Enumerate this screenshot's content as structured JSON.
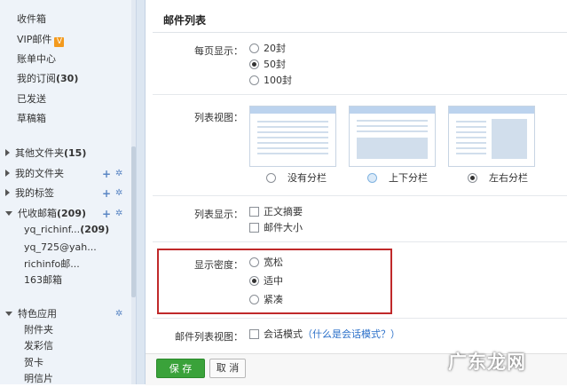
{
  "sidebar": {
    "items": [
      {
        "label": "收件箱"
      },
      {
        "label": "VIP邮件",
        "badge": "V"
      },
      {
        "label": "账单中心"
      },
      {
        "label": "我的订阅",
        "count": "(30)"
      },
      {
        "label": "已发送"
      },
      {
        "label": "草稿箱"
      }
    ],
    "folders": [
      {
        "label": "其他文件夹",
        "count": "(15)"
      },
      {
        "label": "我的文件夹"
      },
      {
        "label": "我的标签"
      },
      {
        "label": "代收邮箱",
        "count": "(209)"
      }
    ],
    "sub_accounts": [
      {
        "label": "yq_richinf...",
        "count": "(209)"
      },
      {
        "label": "yq_725@yah..."
      },
      {
        "label": "richinfo邮..."
      },
      {
        "label": "163邮箱"
      }
    ],
    "features": {
      "label": "特色应用",
      "items": [
        {
          "label": "附件夹"
        },
        {
          "label": "发彩信"
        },
        {
          "label": "贺卡"
        },
        {
          "label": "明信片"
        }
      ]
    }
  },
  "main": {
    "title": "邮件列表",
    "per_page": {
      "label": "每页显示：",
      "options": [
        "20封",
        "50封",
        "100封"
      ],
      "selected": "50封"
    },
    "list_view": {
      "label": "列表视图：",
      "options": [
        "没有分栏",
        "上下分栏",
        "左右分栏"
      ],
      "selected": "左右分栏"
    },
    "list_display": {
      "label": "列表显示：",
      "options": [
        "正文摘要",
        "邮件大小"
      ]
    },
    "density": {
      "label": "显示密度：",
      "options": [
        "宽松",
        "适中",
        "紧凑"
      ],
      "selected": "适中"
    },
    "mail_list_view": {
      "label": "邮件列表视图：",
      "option": "会话模式",
      "link": "（什么是会话模式？）"
    },
    "save_label": "保 存",
    "cancel_label": "取 消"
  },
  "watermark": "广东龙网",
  "colors": {
    "accent_green": "#3aa23a",
    "highlight_red": "#c0292a",
    "link_blue": "#2a6fc9",
    "vip_orange": "#f39a1e"
  }
}
